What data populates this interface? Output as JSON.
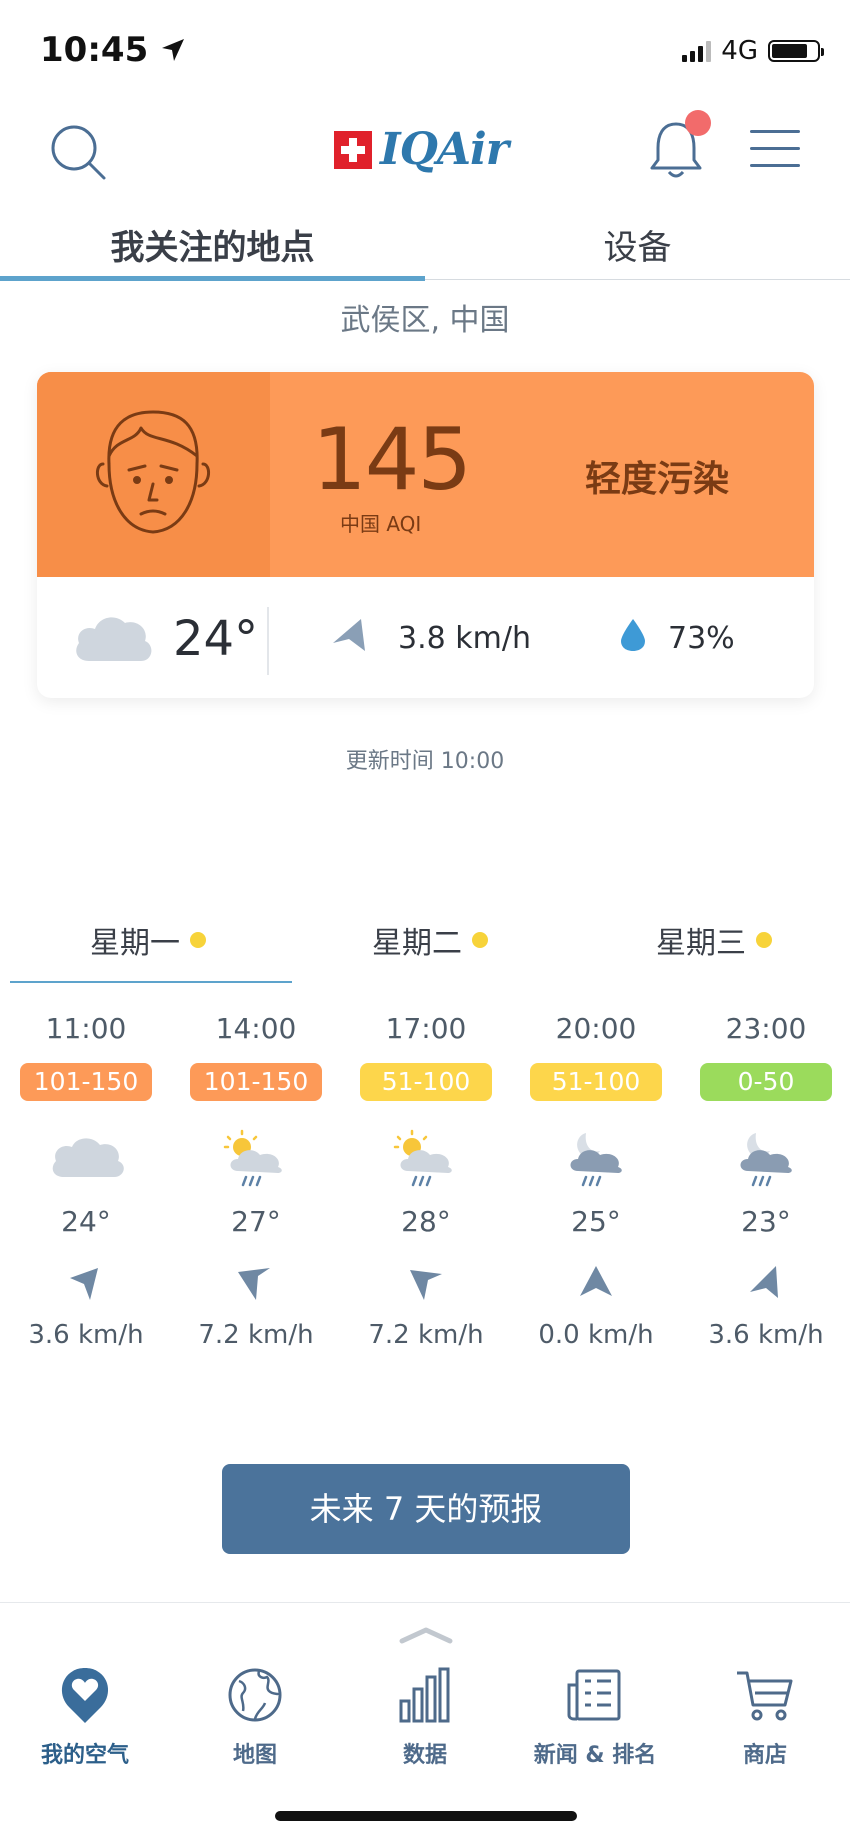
{
  "status_bar": {
    "time": "10:45",
    "network": "4G"
  },
  "header": {
    "logo_text": "IQAir"
  },
  "tabs": [
    {
      "label": "我关注的地点",
      "active": true
    },
    {
      "label": "设备",
      "active": false
    }
  ],
  "location": "武侯区, 中国",
  "aqi_card": {
    "aqi_value": "145",
    "aqi_label": "中国 AQI",
    "aqi_level": "轻度污染",
    "temperature": "24°",
    "wind": "3.8 km/h",
    "humidity": "73%",
    "color": "#fd9a58"
  },
  "updated": "更新时间 10:00",
  "days": [
    {
      "label": "星期一"
    },
    {
      "label": "星期二"
    },
    {
      "label": "星期三"
    }
  ],
  "hourly": [
    {
      "time": "11:00",
      "aqi": "101-150",
      "temp": "24°",
      "wind": "3.6 km/h",
      "icon": "cloud-icon",
      "badge_color": "#fd9a58"
    },
    {
      "time": "14:00",
      "aqi": "101-150",
      "temp": "27°",
      "wind": "7.2 km/h",
      "icon": "sun-rain-icon",
      "badge_color": "#fd9a58"
    },
    {
      "time": "17:00",
      "aqi": "51-100",
      "temp": "28°",
      "wind": "7.2 km/h",
      "icon": "sun-rain-icon",
      "badge_color": "#fdd64b"
    },
    {
      "time": "20:00",
      "aqi": "51-100",
      "temp": "25°",
      "wind": "0.0 km/h",
      "icon": "moon-rain-icon",
      "badge_color": "#fdd64b"
    },
    {
      "time": "23:00",
      "aqi": "0-50",
      "temp": "23°",
      "wind": "3.6 km/h",
      "icon": "moon-rain-icon",
      "badge_color": "#9bdb5c"
    }
  ],
  "forecast_button": "未来 7 天的预报",
  "bottom_nav": [
    {
      "label": "我的空气",
      "icon": "heart-pin-icon",
      "active": true
    },
    {
      "label": "地图",
      "icon": "globe-icon",
      "active": false
    },
    {
      "label": "数据",
      "icon": "bar-chart-icon",
      "active": false
    },
    {
      "label": "新闻 & 排名",
      "icon": "newspaper-icon",
      "active": false
    },
    {
      "label": "商店",
      "icon": "cart-icon",
      "active": false
    }
  ]
}
